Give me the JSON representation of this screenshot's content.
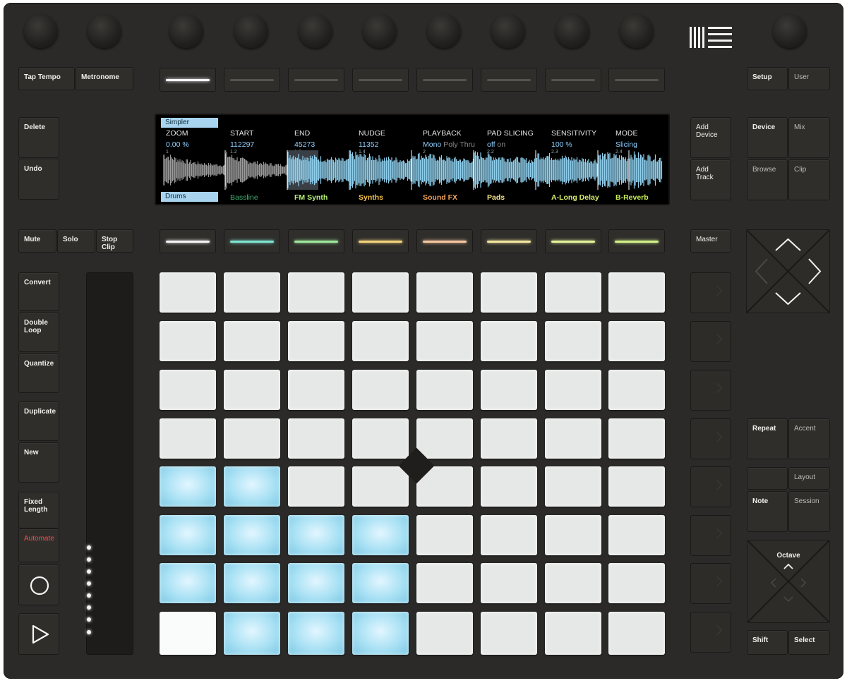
{
  "controller": {
    "logo": "ableton-logo",
    "top_left_buttons": [
      "Tap Tempo",
      "Metronome"
    ],
    "top_right_buttons": [
      "Setup",
      "User"
    ],
    "left_edit_buttons": [
      "Delete",
      "Undo"
    ],
    "mute_solo": [
      "Mute",
      "Solo",
      "Stop\nClip"
    ],
    "left_column": [
      "Convert",
      "Double\nLoop",
      "Quantize",
      "Duplicate",
      "New",
      "Fixed\nLength",
      "Automate"
    ],
    "transport_icons": [
      "record-icon",
      "play-icon"
    ],
    "add_buttons": [
      "Add\nDevice",
      "Add\nTrack"
    ],
    "mode_buttons": [
      "Device",
      "Mix",
      "Browse",
      "Clip"
    ],
    "master_label": "Master",
    "repeat_accent": [
      "Repeat",
      "Accent"
    ],
    "layout_buttons": [
      "Layout",
      "Note",
      "Session"
    ],
    "octave_label": "Octave",
    "shift_select": [
      "Shift",
      "Select"
    ]
  },
  "display": {
    "device_tab": "Simpler",
    "params": [
      {
        "name": "ZOOM",
        "value": "0.00 %"
      },
      {
        "name": "START",
        "value": "112297"
      },
      {
        "name": "END",
        "value": "45273"
      },
      {
        "name": "NUDGE",
        "value": "11352"
      },
      {
        "name": "PLAYBACK",
        "value": "Mono",
        "extra": "Poly Thru"
      },
      {
        "name": "PAD SLICING",
        "value": "off",
        "extra": "on"
      },
      {
        "name": "SENSITIVITY",
        "value": "100 %"
      },
      {
        "name": "MODE",
        "value": "Slicing"
      }
    ],
    "tracks": [
      {
        "name": "Drums",
        "color": "#0b2a3a",
        "selected": true
      },
      {
        "name": "Bassline",
        "color": "#3fae70"
      },
      {
        "name": "FM Synth",
        "color": "#b6f07a"
      },
      {
        "name": "Synths",
        "color": "#f7c34a"
      },
      {
        "name": "Sound FX",
        "color": "#f2a25a"
      },
      {
        "name": "Pads",
        "color": "#f4e58a"
      },
      {
        "name": "A-Long Delay",
        "color": "#d9f06a"
      },
      {
        "name": "B-Reverb",
        "color": "#c8ee5a"
      }
    ],
    "slice_markers": [
      "1",
      "1.2",
      "1.3",
      "1.4",
      "2",
      "2.2",
      "2.3",
      "2.4"
    ]
  },
  "upper_strip_colors": [
    "#ffffff",
    "#555452",
    "#555452",
    "#555452",
    "#555452",
    "#555452",
    "#555452",
    "#555452"
  ],
  "lower_strip_colors": [
    "#f4f4f4",
    "#7fe3d0",
    "#9fe89a",
    "#f2d27a",
    "#f4c6a0",
    "#f3e7a0",
    "#e2f29a",
    "#d2f08a"
  ],
  "pad_grid": [
    [
      "w",
      "w",
      "w",
      "w",
      "w",
      "w",
      "w",
      "w"
    ],
    [
      "w",
      "w",
      "w",
      "w",
      "w",
      "w",
      "w",
      "w"
    ],
    [
      "w",
      "w",
      "w",
      "w",
      "w",
      "w",
      "w",
      "w"
    ],
    [
      "w",
      "w",
      "w",
      "w",
      "w",
      "w",
      "w",
      "w"
    ],
    [
      "b",
      "b",
      "w",
      "w",
      "w",
      "w",
      "w",
      "w"
    ],
    [
      "b",
      "b",
      "b",
      "b",
      "w",
      "w",
      "w",
      "w"
    ],
    [
      "b",
      "b",
      "b",
      "b",
      "w",
      "w",
      "w",
      "w"
    ],
    [
      "W",
      "b",
      "b",
      "b",
      "w",
      "w",
      "w",
      "w"
    ]
  ]
}
